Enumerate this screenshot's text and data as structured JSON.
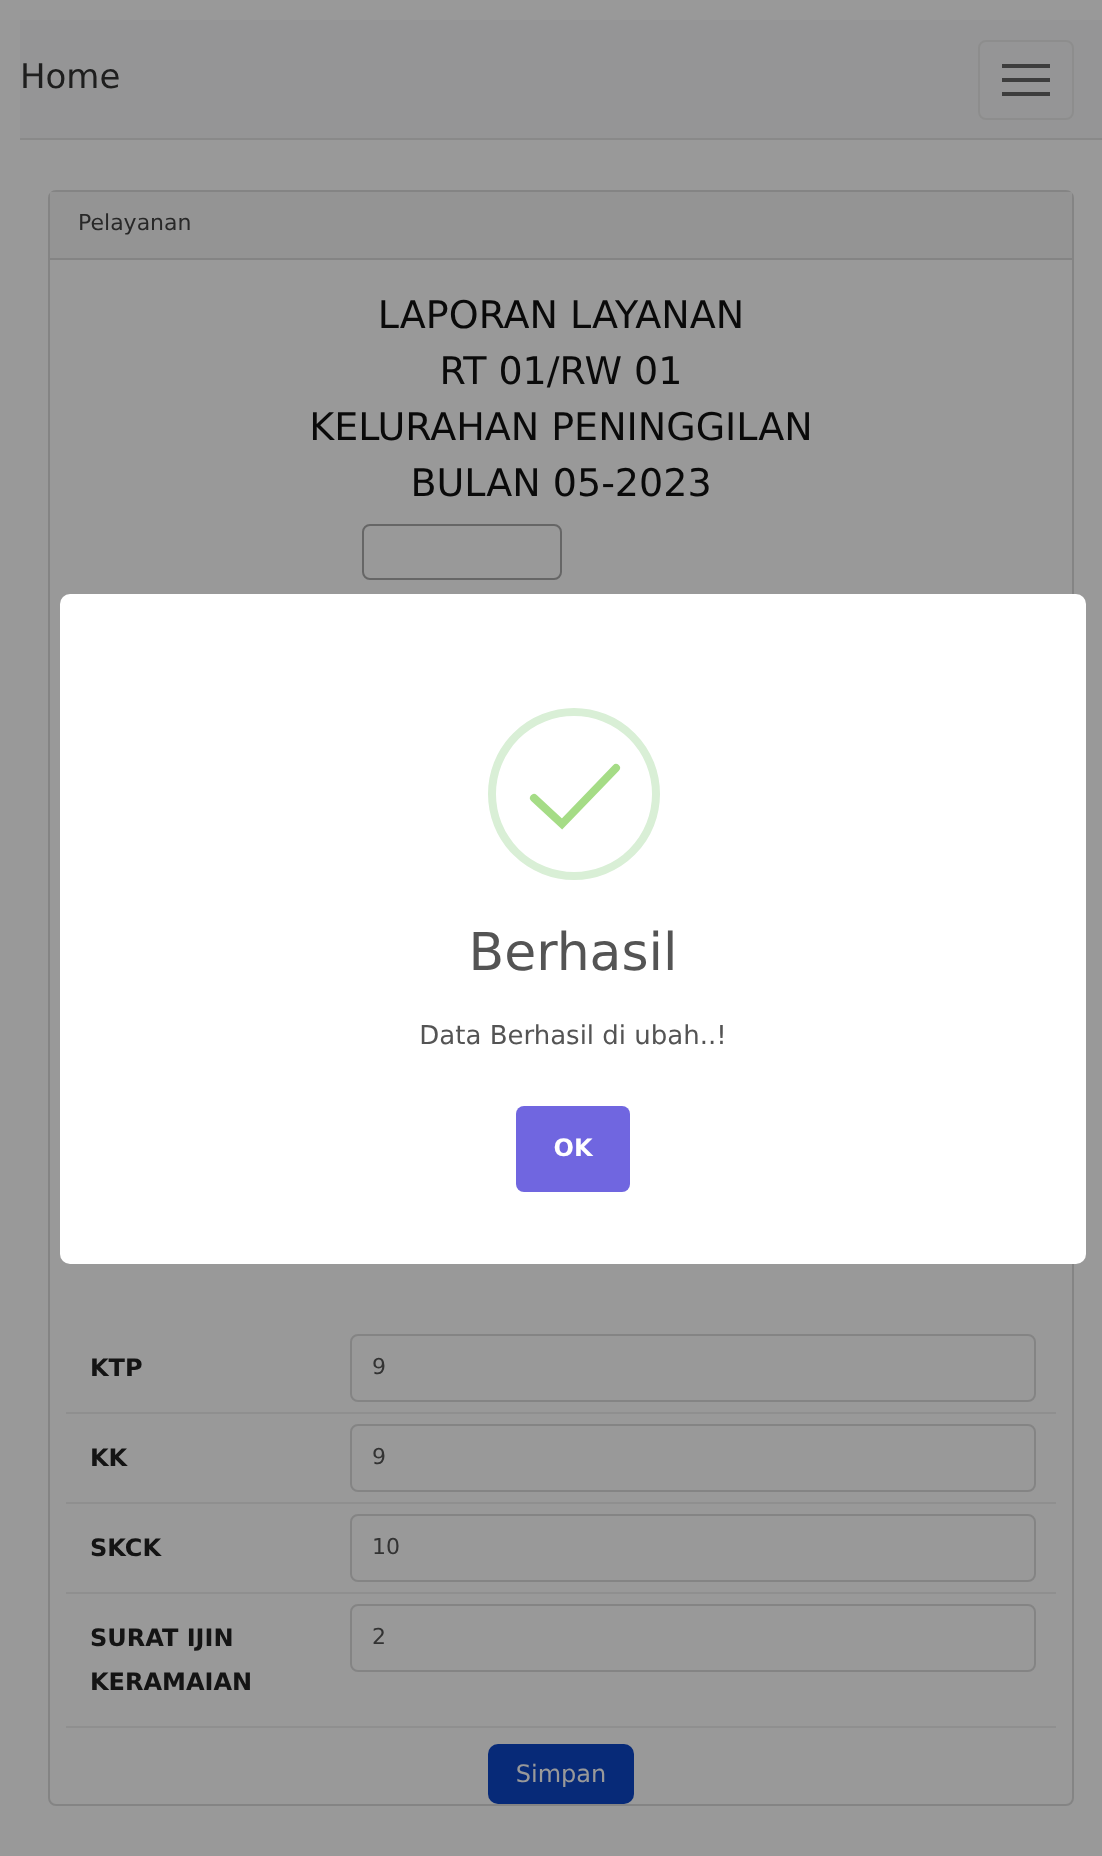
{
  "navbar": {
    "brand": "Home"
  },
  "card": {
    "header": "Pelayanan",
    "title_lines": [
      "LAPORAN LAYANAN",
      "RT 01/RW 01",
      "KELURAHAN PENINGGILAN",
      "BULAN 05-2023"
    ],
    "fields": [
      {
        "label": "KTP",
        "value": "9"
      },
      {
        "label": "KK",
        "value": "9"
      },
      {
        "label": "SKCK",
        "value": "10"
      },
      {
        "label": "SURAT IJIN KERAMAIAN",
        "value": "2"
      }
    ],
    "save_button": "Simpan"
  },
  "dialog": {
    "title": "Berhasil",
    "message": "Data Berhasil di ubah..!",
    "confirm_button": "OK"
  }
}
